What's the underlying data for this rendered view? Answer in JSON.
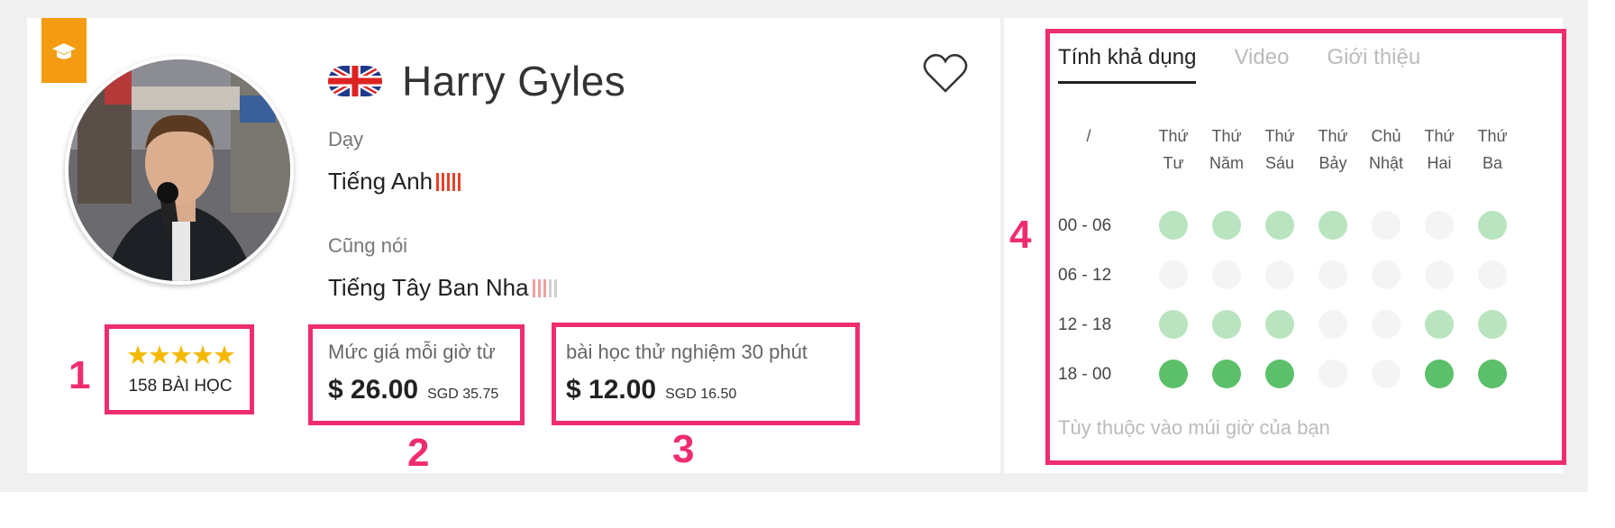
{
  "tutor": {
    "name": "Harry Gyles",
    "teaches_label": "Dạy",
    "teaches_language": "Tiếng Anh",
    "also_speaks_label": "Cũng nói",
    "also_speaks_language": "Tiếng Tây Ban Nha"
  },
  "rating": {
    "stars": "★★★★★",
    "lessons": "158 BÀI HỌC"
  },
  "pricing": {
    "hourly_label": "Mức giá mỗi giờ từ",
    "hourly_price": "$ 26.00",
    "hourly_local": "SGD 35.75",
    "trial_label": "bài học thử nghiệm 30 phút",
    "trial_price": "$ 12.00",
    "trial_local": "SGD 16.50"
  },
  "annotations": [
    "1",
    "2",
    "3",
    "4"
  ],
  "availability": {
    "tabs": [
      "Tính khả dụng",
      "Video",
      "Giới thiệu"
    ],
    "corner_label": "/",
    "days": [
      [
        "Thứ",
        "Tư"
      ],
      [
        "Thứ",
        "Năm"
      ],
      [
        "Thứ",
        "Sáu"
      ],
      [
        "Thứ",
        "Bảy"
      ],
      [
        "Chủ",
        "Nhật"
      ],
      [
        "Thứ",
        "Hai"
      ],
      [
        "Thứ",
        "Ba"
      ]
    ],
    "time_slots": [
      "00 - 06",
      "06 - 12",
      "12 - 18",
      "18 - 00"
    ],
    "levels": [
      [
        1,
        1,
        1,
        1,
        0,
        0,
        1
      ],
      [
        0,
        0,
        0,
        0,
        0,
        0,
        0
      ],
      [
        1,
        1,
        1,
        0,
        0,
        1,
        1
      ],
      [
        2,
        2,
        2,
        0,
        0,
        2,
        2
      ]
    ],
    "note": "Tùy thuộc vào múi giờ của bạn"
  },
  "colors": {
    "highlight": "#ef2d6e",
    "bookmark": "#f39c12",
    "star": "#f5b800",
    "avail_none": "#f4f4f4",
    "avail_light": "#b9e4bf",
    "avail_full": "#5cbf6a",
    "native_bar": "#e8402c",
    "fluent_bar_1": "#f1a0a0",
    "fluent_bar_2": "#d0d0d0"
  },
  "icons": [
    "graduation-cap-icon",
    "uk-flag-icon",
    "heart-icon"
  ]
}
